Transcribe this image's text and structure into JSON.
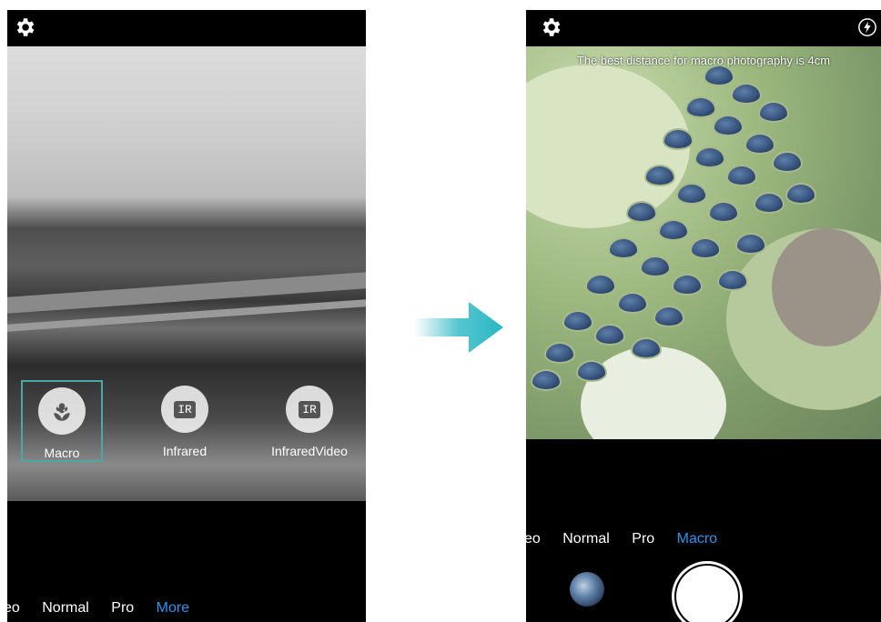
{
  "left_screen": {
    "mode_tiles": [
      {
        "label": "Macro",
        "icon": "flower-icon",
        "selected": true
      },
      {
        "label": "Infrared",
        "icon": "ir-camera-icon",
        "badge": "IR"
      },
      {
        "label": "InfraredVideo",
        "icon": "ir-video-icon",
        "badge": "IR"
      }
    ],
    "mode_bar": [
      "eo",
      "Normal",
      "Pro",
      "More"
    ],
    "active_mode": "More"
  },
  "right_screen": {
    "hint": "The best distance for macro photography is 4cm",
    "mode_bar": [
      "eo",
      "Normal",
      "Pro",
      "Macro"
    ],
    "active_mode": "Macro"
  },
  "colors": {
    "accent": "#2196f3",
    "selection": "#4aa8a8",
    "arrow": "#2ab7c4"
  },
  "icons": [
    "gear-icon",
    "flash-auto-icon",
    "flower-icon",
    "ir-camera-icon",
    "ir-video-icon",
    "transition-arrow"
  ]
}
